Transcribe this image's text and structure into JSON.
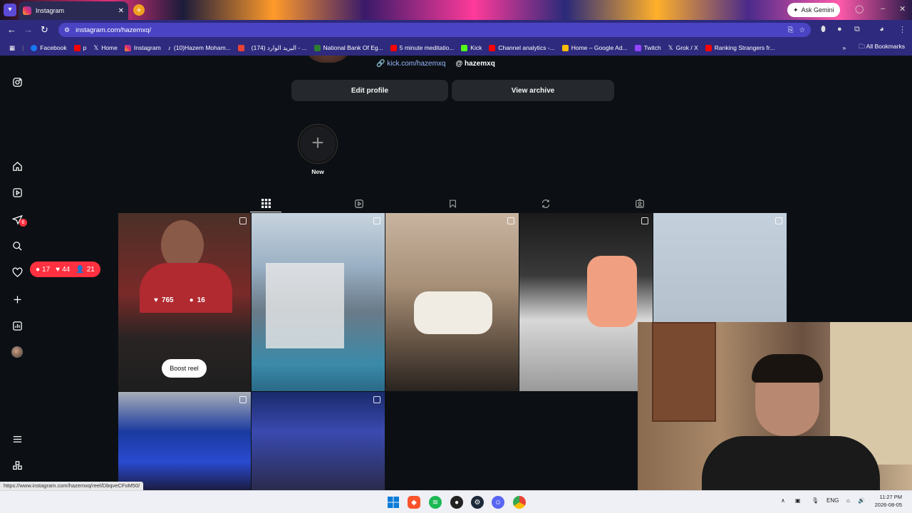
{
  "browser": {
    "tab_title": "Instagram",
    "url": "instagram.com/hazemxq/",
    "gemini_label": "Ask Gemini",
    "bookmarks": [
      {
        "label": "Facebook",
        "icon": "facebook-icon",
        "color": "#1877f2"
      },
      {
        "label": "p",
        "icon": "youtube-icon",
        "color": "#ff0000"
      },
      {
        "label": "Home",
        "icon": "x-icon",
        "color": "#000000"
      },
      {
        "label": "Instagram",
        "icon": "instagram-icon",
        "color": "#e1306c"
      },
      {
        "label": "(10)Hazem Moham...",
        "icon": "tiktok-icon",
        "color": "#000000"
      },
      {
        "label": "",
        "icon": "gmail-icon",
        "color": "#ea4335"
      },
      {
        "label": "(174) البريد الوارد - ...",
        "icon": "outlook-icon",
        "color": "#0078d4"
      },
      {
        "label": "National Bank Of Eg...",
        "icon": "bank-icon",
        "color": "#2e7d32"
      },
      {
        "label": "5 minute meditatio...",
        "icon": "youtube-icon",
        "color": "#ff0000"
      },
      {
        "label": "Kick",
        "icon": "kick-icon",
        "color": "#53fc18"
      },
      {
        "label": "Channel analytics -...",
        "icon": "youtube-icon",
        "color": "#ff0000"
      },
      {
        "label": "Home – Google Ad...",
        "icon": "google-ads-icon",
        "color": "#fbbc04"
      },
      {
        "label": "Twitch",
        "icon": "twitch-icon",
        "color": "#9146ff"
      },
      {
        "label": "Grok / X",
        "icon": "x-icon",
        "color": "#000000"
      },
      {
        "label": "Ranking Strangers fr...",
        "icon": "youtube-icon",
        "color": "#ff0000"
      }
    ],
    "all_bookmarks": "All Bookmarks",
    "more_bookmarks": "»",
    "status_url": "https://www.instagram.com/hazemxq/reel/DbqveCFoM50/"
  },
  "profile": {
    "kick_link": "kick.com/hazemxq",
    "threads_handle": "hazemxq",
    "edit_profile": "Edit profile",
    "view_archive": "View archive",
    "new_highlight": "New"
  },
  "notifications": {
    "comments": "17",
    "likes": "44",
    "follows": "21",
    "messages_badge": "6"
  },
  "grid": {
    "hover_likes": "765",
    "hover_comments": "16",
    "boost_label": "Boost reel"
  },
  "taskbar": {
    "lang": "ENG",
    "time": "11:27 PM",
    "date": "2026-08-05"
  },
  "colors": {
    "accent_red": "#ff3040",
    "page_bg": "#0c1014",
    "button_bg": "#25292e",
    "addr_bg": "#2e2a7e"
  }
}
